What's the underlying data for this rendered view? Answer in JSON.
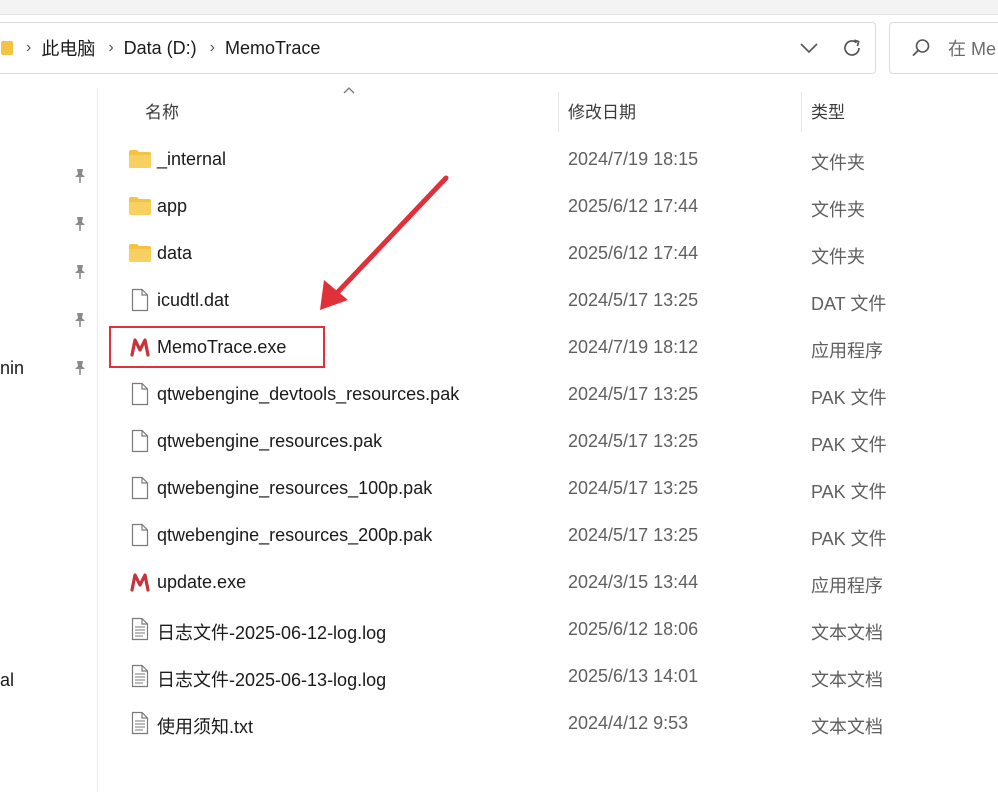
{
  "breadcrumb": {
    "items": [
      "此电脑",
      "Data (D:)",
      "MemoTrace"
    ],
    "separator": ">"
  },
  "search": {
    "placeholder": "在 Me"
  },
  "nav": {
    "fragments": [
      "nin",
      "al"
    ]
  },
  "columns": {
    "name": "名称",
    "date": "修改日期",
    "type": "类型"
  },
  "files": [
    {
      "name": "_internal",
      "date": "2024/7/19 18:15",
      "type": "文件夹",
      "icon": "folder-icon"
    },
    {
      "name": "app",
      "date": "2025/6/12 17:44",
      "type": "文件夹",
      "icon": "folder-icon"
    },
    {
      "name": "data",
      "date": "2025/6/12 17:44",
      "type": "文件夹",
      "icon": "folder-icon"
    },
    {
      "name": "icudtl.dat",
      "date": "2024/5/17 13:25",
      "type": "DAT 文件",
      "icon": "file-icon"
    },
    {
      "name": "MemoTrace.exe",
      "date": "2024/7/19 18:12",
      "type": "应用程序",
      "icon": "memotrace-app-icon"
    },
    {
      "name": "qtwebengine_devtools_resources.pak",
      "date": "2024/5/17 13:25",
      "type": "PAK 文件",
      "icon": "file-icon"
    },
    {
      "name": "qtwebengine_resources.pak",
      "date": "2024/5/17 13:25",
      "type": "PAK 文件",
      "icon": "file-icon"
    },
    {
      "name": "qtwebengine_resources_100p.pak",
      "date": "2024/5/17 13:25",
      "type": "PAK 文件",
      "icon": "file-icon"
    },
    {
      "name": "qtwebengine_resources_200p.pak",
      "date": "2024/5/17 13:25",
      "type": "PAK 文件",
      "icon": "file-icon"
    },
    {
      "name": "update.exe",
      "date": "2024/3/15 13:44",
      "type": "应用程序",
      "icon": "memotrace-app-icon"
    },
    {
      "name": "日志文件-2025-06-12-log.log",
      "date": "2025/6/12 18:06",
      "type": "文本文档",
      "icon": "text-document-icon"
    },
    {
      "name": "日志文件-2025-06-13-log.log",
      "date": "2025/6/13 14:01",
      "type": "文本文档",
      "icon": "text-document-icon"
    },
    {
      "name": "使用须知.txt",
      "date": "2024/4/12 9:53",
      "type": "文本文档",
      "icon": "text-document-icon"
    }
  ],
  "colors": {
    "annotation": "#e0313a",
    "folder": "#f5c342",
    "app_icon": "#c8323a"
  }
}
